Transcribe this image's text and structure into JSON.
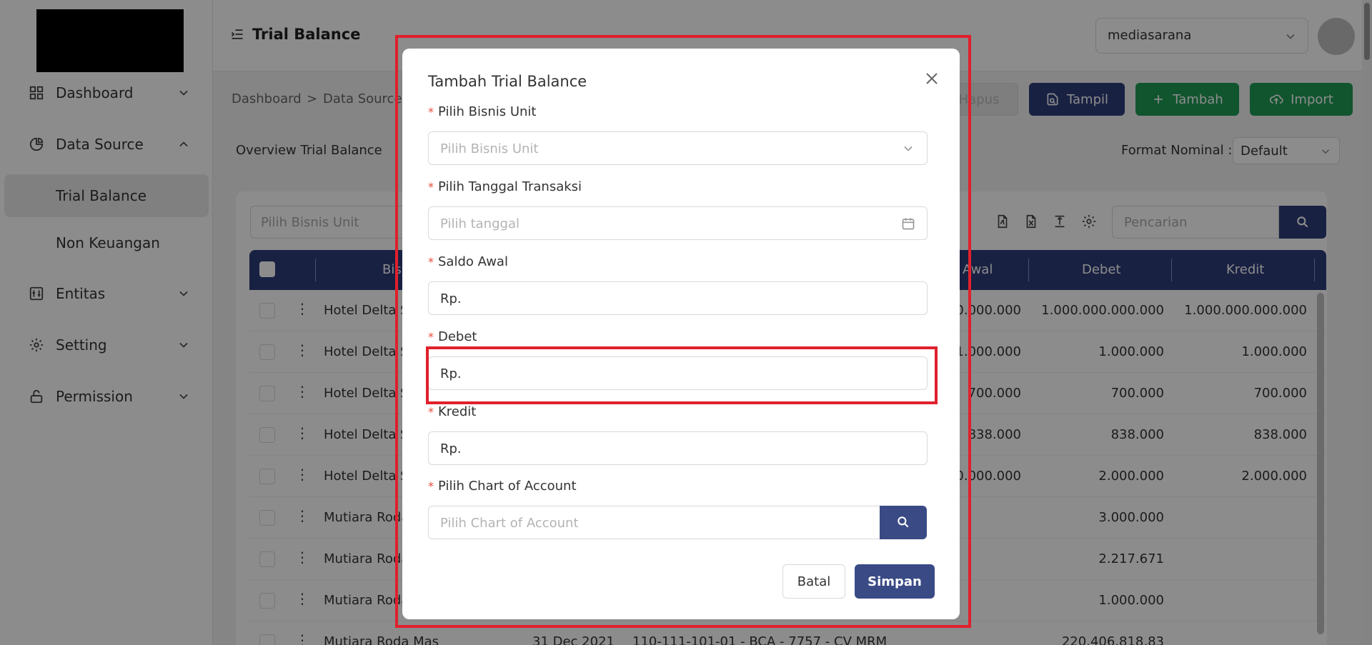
{
  "sidebar": {
    "items": [
      {
        "label": "Dashboard"
      },
      {
        "label": "Data Source"
      },
      {
        "label": "Trial Balance"
      },
      {
        "label": "Non Keuangan"
      },
      {
        "label": "Entitas"
      },
      {
        "label": "Setting"
      },
      {
        "label": "Permission"
      }
    ]
  },
  "header": {
    "title": "Trial Balance",
    "workspace": "mediasarana"
  },
  "breadcrumb": {
    "items": [
      "Dashboard",
      ">",
      "Data Source"
    ]
  },
  "toolbar": {
    "hapus": "Hapus",
    "tampil": "Tampil",
    "tambah": "Tambah",
    "import": "Import"
  },
  "overview": {
    "title": "Overview Trial Balance",
    "format_label": "Format Nominal :",
    "format_value": "Default"
  },
  "filters": {
    "bisnis_unit_placeholder": "Pilih Bisnis Unit",
    "search_placeholder": "Pencarian"
  },
  "table": {
    "headers": [
      "Bis",
      "Awal",
      "Debet",
      "Kredit"
    ],
    "rows": [
      {
        "bu": "Hotel Delta S",
        "awal": "0.000.000",
        "debet": "1.000.000.000.000",
        "kredit": "1.000.000.000.000"
      },
      {
        "bu": "Hotel Delta S",
        "awal": "1.000.000",
        "debet": "1.000.000",
        "kredit": "1.000.000"
      },
      {
        "bu": "Hotel Delta S",
        "awal": "700.000",
        "debet": "700.000",
        "kredit": "700.000"
      },
      {
        "bu": "Hotel Delta S",
        "awal": "838.000",
        "debet": "838.000",
        "kredit": "838.000"
      },
      {
        "bu": "Hotel Delta S",
        "awal": "0.000.000",
        "debet": "2.000.000",
        "kredit": "2.000.000"
      },
      {
        "bu": "Mutiara Roda",
        "awal": "",
        "debet": "3.000.000",
        "kredit": ""
      },
      {
        "bu": "Mutiara Roda",
        "awal": "",
        "debet": "2.217.671",
        "kredit": ""
      },
      {
        "bu": "Mutiara Roda",
        "awal": "",
        "debet": "1.000.000",
        "kredit": ""
      },
      {
        "bu": "Mutiara Roda Mas",
        "date": "31 Dec 2021",
        "account": "110-111-101-01 - BCA - 7757 - CV MRM",
        "awal": "",
        "debet": "220.406.818,83",
        "kredit": ""
      }
    ]
  },
  "modal": {
    "title": "Tambah Trial Balance",
    "fields": {
      "bisnis_unit": {
        "label": "Pilih Bisnis Unit",
        "placeholder": "Pilih Bisnis Unit"
      },
      "tanggal": {
        "label": "Pilih Tanggal Transaksi",
        "placeholder": "Pilih tanggal"
      },
      "saldo_awal": {
        "label": "Saldo Awal",
        "value": "Rp."
      },
      "debet": {
        "label": "Debet",
        "value": "Rp."
      },
      "kredit": {
        "label": "Kredit",
        "value": "Rp."
      },
      "coa": {
        "label": "Pilih Chart of Account",
        "placeholder": "Pilih Chart of Account"
      }
    },
    "required_mark": "*",
    "cancel": "Batal",
    "save": "Simpan"
  },
  "colors": {
    "primary": "#2f3d7a",
    "success": "#1f9c56",
    "annotation": "#e0202c"
  }
}
